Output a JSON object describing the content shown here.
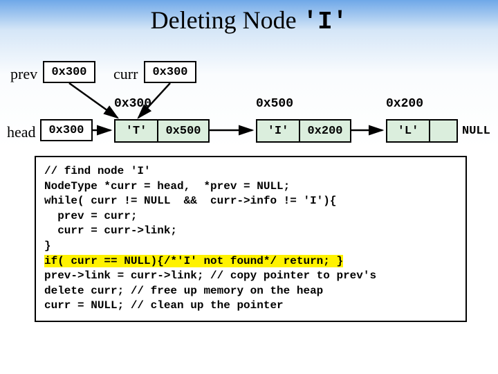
{
  "title_prefix": "Deleting Node",
  "title_mono": "'I'",
  "labels": {
    "prev": "prev",
    "curr": "curr",
    "head": "head"
  },
  "pointers": {
    "prev": "0x300",
    "curr": "0x300",
    "head": "0x300"
  },
  "addr": {
    "n1": "0x300",
    "n2": "0x500",
    "n3": "0x200"
  },
  "nodes": {
    "n1": {
      "info": "'T'",
      "link": "0x500"
    },
    "n2": {
      "info": "'I'",
      "link": "0x200"
    },
    "n3": {
      "info": "'L'",
      "link": ""
    }
  },
  "null_label": "NULL",
  "code": {
    "l1": "// find node 'I'",
    "l2": "NodeType *curr = head,  *prev = NULL;",
    "l3": "while( curr != NULL  &&  curr->info != 'I'){",
    "l4": "  prev = curr;",
    "l5": "  curr = curr->link;",
    "l6": "}",
    "l7": "if( curr == NULL){/*'I' not found*/ return; }",
    "l8": "prev->link = curr->link; // copy pointer to prev's",
    "l9": "delete curr; // free up memory on the heap",
    "l10": "curr = NULL; // clean up the pointer"
  }
}
